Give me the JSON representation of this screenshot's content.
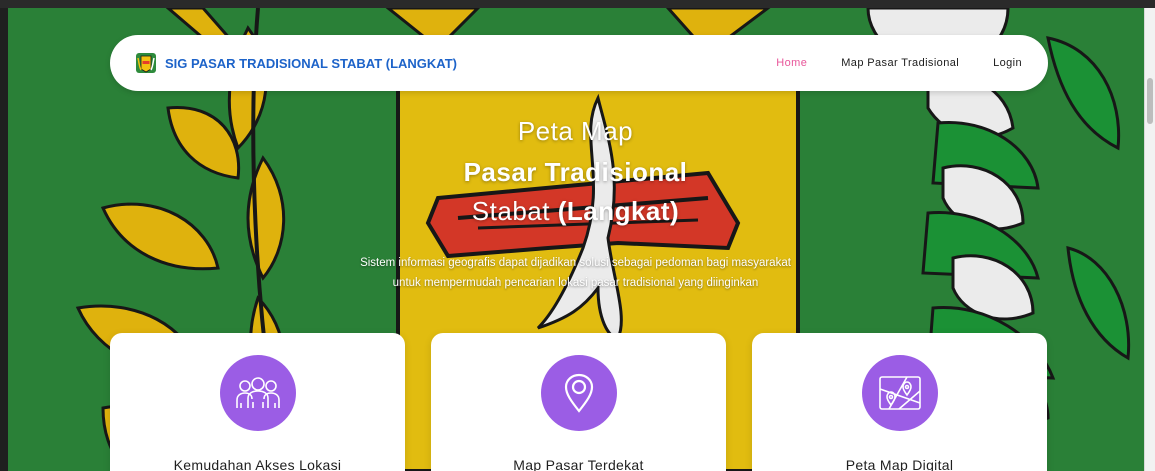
{
  "nav": {
    "brand": "SIG PASAR TRADISIONAL STABAT (LANGKAT)",
    "links": [
      {
        "label": "Home",
        "active": true
      },
      {
        "label": "Map Pasar Tradisional",
        "active": false
      },
      {
        "label": "Login",
        "active": false
      }
    ]
  },
  "hero": {
    "line1": "Peta Map",
    "line2": "Pasar Tradisional",
    "line3_plain": "Stabat",
    "line3_bold": "(Langkat)",
    "description": "Sistem informasi geografis dapat dijadikan solusi sebagai pedoman bagi masyarakat untuk mempermudah pencarian lokasi pasar tradisional yang diinginkan"
  },
  "cards": [
    {
      "title": "Kemudahan Akses Lokasi",
      "icon": "people-group-icon"
    },
    {
      "title": "Map Pasar Terdekat",
      "icon": "location-pin-icon"
    },
    {
      "title": "Peta Map Digital",
      "icon": "map-icon"
    }
  ],
  "colors": {
    "accent_purple": "#9b5de5",
    "brand_blue": "#1d63c9",
    "active_pink": "#e8569a",
    "background_green": "#2e8b3c",
    "emblem_yellow": "#f2c20f"
  }
}
